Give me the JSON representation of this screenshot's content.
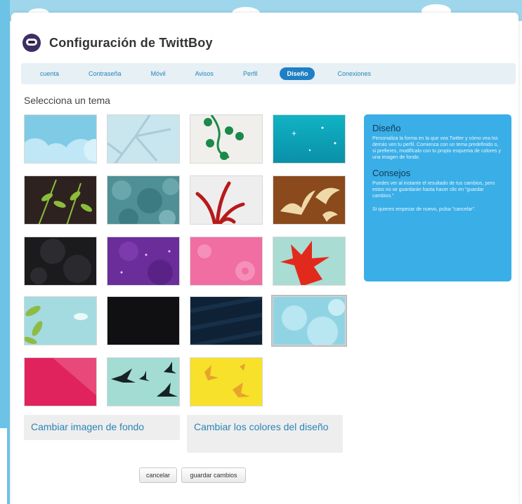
{
  "window": {
    "title": "Configuración de TwittBoy"
  },
  "tabs": [
    {
      "label": "cuenta",
      "active": false
    },
    {
      "label": "Contraseña",
      "active": false
    },
    {
      "label": "Móvil",
      "active": false
    },
    {
      "label": "Avisos",
      "active": false
    },
    {
      "label": "Perfil",
      "active": false
    },
    {
      "label": "Diseño",
      "active": true
    },
    {
      "label": "Conexiones",
      "active": false
    }
  ],
  "themes": {
    "heading": "Selecciona un tema",
    "items": [
      {
        "name": "clouds-blue",
        "selected": false
      },
      {
        "name": "branches-light",
        "selected": false
      },
      {
        "name": "green-vine",
        "selected": false
      },
      {
        "name": "teal-stars",
        "selected": false
      },
      {
        "name": "dark-leaves",
        "selected": false
      },
      {
        "name": "teal-foliage",
        "selected": false
      },
      {
        "name": "red-plant",
        "selected": false
      },
      {
        "name": "brown-birds",
        "selected": false
      },
      {
        "name": "dark-smoke",
        "selected": false
      },
      {
        "name": "purple-sparkle",
        "selected": false
      },
      {
        "name": "pink-flowers",
        "selected": false
      },
      {
        "name": "red-leaf-mint",
        "selected": false
      },
      {
        "name": "green-leaves-sky",
        "selected": false
      },
      {
        "name": "black-pattern",
        "selected": false
      },
      {
        "name": "navy-stripes",
        "selected": false
      },
      {
        "name": "light-blue-clouds",
        "selected": true
      },
      {
        "name": "pink-diagonal",
        "selected": false
      },
      {
        "name": "birds-mint",
        "selected": false
      },
      {
        "name": "yellow-splash",
        "selected": false
      }
    ]
  },
  "sidebar": {
    "design_title": "Diseño",
    "design_text": "Personaliza la forma en la que vea Twitter y cómo vea los demás ven tu perfil. Comienza con un tema predefinido o, si prefieres, modifícalo con tu propio esquema de colores y una imagen de fondo.",
    "tips_title": "Consejos",
    "tips_text1": "Puedes ver al instante el resultado de tus cambios, pero estos no se guardarán hasta hacer clic en \"guardar cambios.\"",
    "tips_text2": "Si quieres empezar de nuevo, pulsa \"cancelar\"."
  },
  "actions": {
    "change_background": "Cambiar imagen de fondo",
    "change_colors": "Cambiar los colores del diseño"
  },
  "buttons": {
    "cancel": "cancelar",
    "save": "guardar cambios"
  }
}
